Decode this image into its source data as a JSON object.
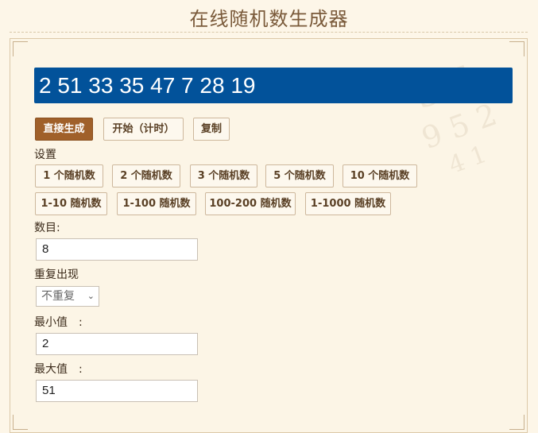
{
  "page": {
    "title": "在线随机数生成器"
  },
  "result": {
    "text": "2 51 33 35 47 7 28 19"
  },
  "actions": {
    "generate": "直接生成",
    "start_timed": "开始（计时）",
    "copy": "复制"
  },
  "settings": {
    "heading": "设置",
    "presets_row1": [
      "1 个随机数",
      "2 个随机数",
      "3 个随机数",
      "5 个随机数",
      "10 个随机数"
    ],
    "presets_row2": [
      "1-10 随机数",
      "1-100 随机数",
      "100-200 随机数",
      "1-1000 随机数"
    ],
    "count_label": "数目:",
    "count_value": "8",
    "repeat_label": "重复出现",
    "repeat_value": "不重复",
    "min_label": "最小值　:",
    "min_value": "2",
    "max_label": "最大值　:",
    "max_value": "51"
  },
  "colors": {
    "result_bg": "#02529a",
    "primary_button": "#a0602a",
    "page_bg": "#fdf6e8"
  }
}
